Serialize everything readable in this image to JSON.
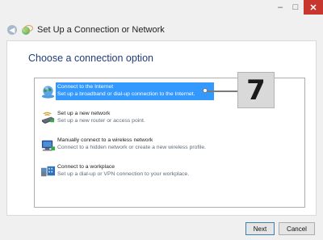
{
  "window": {
    "title": "Set Up a Connection or Network",
    "controls": {
      "minimize": "–",
      "maximize": "□",
      "close": "✕"
    }
  },
  "content": {
    "heading": "Choose a connection option",
    "options": [
      {
        "title": "Connect to the Internet",
        "description": "Set up a broadband or dial-up connection to the Internet.",
        "selected": true,
        "icon": "globe-network-icon"
      },
      {
        "title": "Set up a new network",
        "description": "Set up a new router or access point.",
        "selected": false,
        "icon": "router-icon"
      },
      {
        "title": "Manually connect to a wireless network",
        "description": "Connect to a hidden network or create a new wireless profile.",
        "selected": false,
        "icon": "wireless-network-icon"
      },
      {
        "title": "Connect to a workplace",
        "description": "Set up a dial-up or VPN connection to your workplace.",
        "selected": false,
        "icon": "workplace-connection-icon"
      }
    ]
  },
  "callout": {
    "number": "7"
  },
  "footer": {
    "next_label": "Next",
    "cancel_label": "Cancel"
  },
  "colors": {
    "selection": "#3399ff",
    "heading": "#1f3d7a",
    "close": "#c7372f"
  }
}
